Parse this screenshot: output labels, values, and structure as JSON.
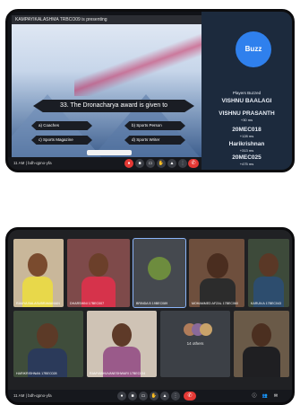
{
  "top_screen": {
    "presenting_bar": "KAMPAYIKALASHMA TRBCO09 is presenting",
    "question": "33. The Dronacharya award is given to",
    "options": [
      "a) Coaches",
      "b) Sports Person",
      "c) Sports Magazine",
      "d) Sports Writer"
    ],
    "sidebar": {
      "buzz_label": "Buzz",
      "players_heading": "Players Buzzed",
      "players": [
        {
          "name": "VISHNU BAALAGI",
          "time": ""
        },
        {
          "name": "VISHNU PRASANTH",
          "time": "+30 ms"
        },
        {
          "name": "20MEC018",
          "time": "+128 ms"
        },
        {
          "name": "Harikrishnan",
          "time": "+313 ms"
        },
        {
          "name": "20MEC025",
          "time": "+475 ms"
        }
      ]
    },
    "meeting_code": "11 AM | bdh-qpno-yfa"
  },
  "bottom_screen": {
    "participants_row1": [
      "RAMYA BALASUBRAMANIAN",
      "DHARSHINI 17BEC007",
      "BRINDA B 19BEC089",
      "MOHAMMED AFZAL 17BEC060",
      "KARUN A 17BEC043"
    ],
    "participants_row2": [
      "HARIKRISHNAN 17BEC028",
      "RAMYABHUVANESHWARI 17BEC034",
      "",
      ""
    ],
    "others_label": "14 others",
    "meeting_code": "11 AM | bdh-qpno-yfa"
  },
  "colors": {
    "buzz": "#2f80ed",
    "sidebar": "#1c2a3d",
    "hangup": "#e53935"
  }
}
